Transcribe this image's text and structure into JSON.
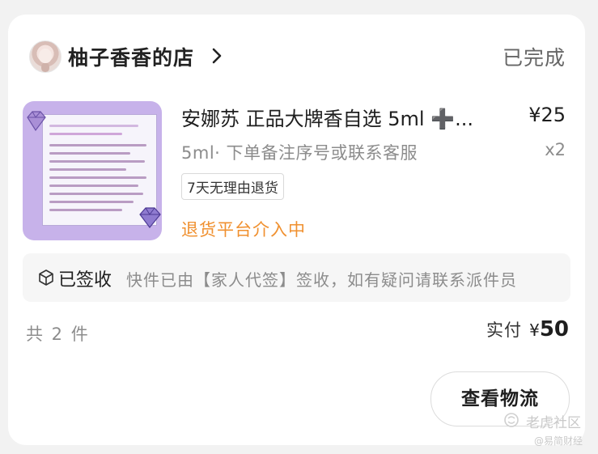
{
  "shop": {
    "name": "柚子香香的店",
    "status": "已完成"
  },
  "product": {
    "title": "安娜苏 正品大牌香自选 5ml ➕...",
    "price": "¥25",
    "spec": "5ml· 下单备注序号或联系客服",
    "quantity": "x2",
    "tag": "7天无理由退货",
    "refund_status": "退货平台介入中"
  },
  "logistics": {
    "status": "已签收",
    "message": "快件已由【家人代签】签收，如有疑问请联系派件员"
  },
  "summary": {
    "count": "共 2 件",
    "paid_label": "实付",
    "currency": "¥",
    "amount": "50"
  },
  "actions": {
    "view_logistics": "查看物流"
  },
  "watermark": {
    "line1": "老虎社区",
    "line2": "@易简财经"
  },
  "colors": {
    "refund": "#f0902f",
    "background": "#f2f2f2",
    "card": "#ffffff"
  },
  "icons": [
    "avatar",
    "chevron-right-icon",
    "box-icon",
    "gem-icon"
  ]
}
